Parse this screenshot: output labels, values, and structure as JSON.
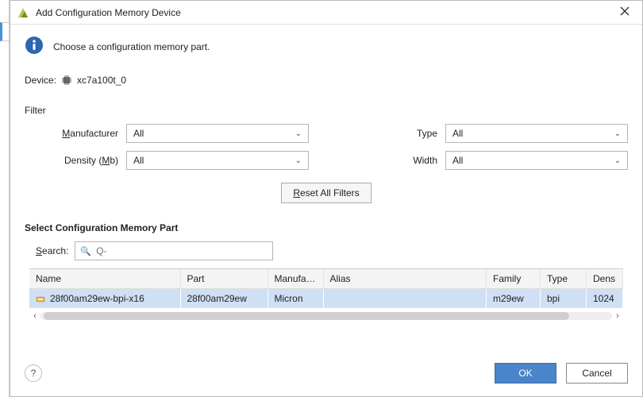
{
  "titlebar": {
    "title": "Add Configuration Memory Device"
  },
  "info": {
    "text": "Choose a configuration memory part."
  },
  "device": {
    "label": "Device:",
    "value": "xc7a100t_0"
  },
  "filter": {
    "section": "Filter",
    "manufacturer_label": "Manufacturer",
    "manufacturer_value": "All",
    "density_label": "Density (Mb)",
    "density_value": "All",
    "type_label": "Type",
    "type_value": "All",
    "width_label": "Width",
    "width_value": "All",
    "reset_label": "Reset All Filters"
  },
  "partlist": {
    "section": "Select Configuration Memory Part",
    "search_label": "Search:",
    "search_placeholder": "Q-",
    "columns": {
      "name": "Name",
      "part": "Part",
      "manufacturer": "Manufact...",
      "alias": "Alias",
      "family": "Family",
      "type": "Type",
      "density": "Dens"
    },
    "rows": [
      {
        "name": "28f00am29ew-bpi-x16",
        "part": "28f00am29ew",
        "manufacturer": "Micron",
        "alias": "",
        "family": "m29ew",
        "type": "bpi",
        "density": "1024"
      }
    ]
  },
  "buttons": {
    "ok": "OK",
    "cancel": "Cancel",
    "help": "?"
  }
}
